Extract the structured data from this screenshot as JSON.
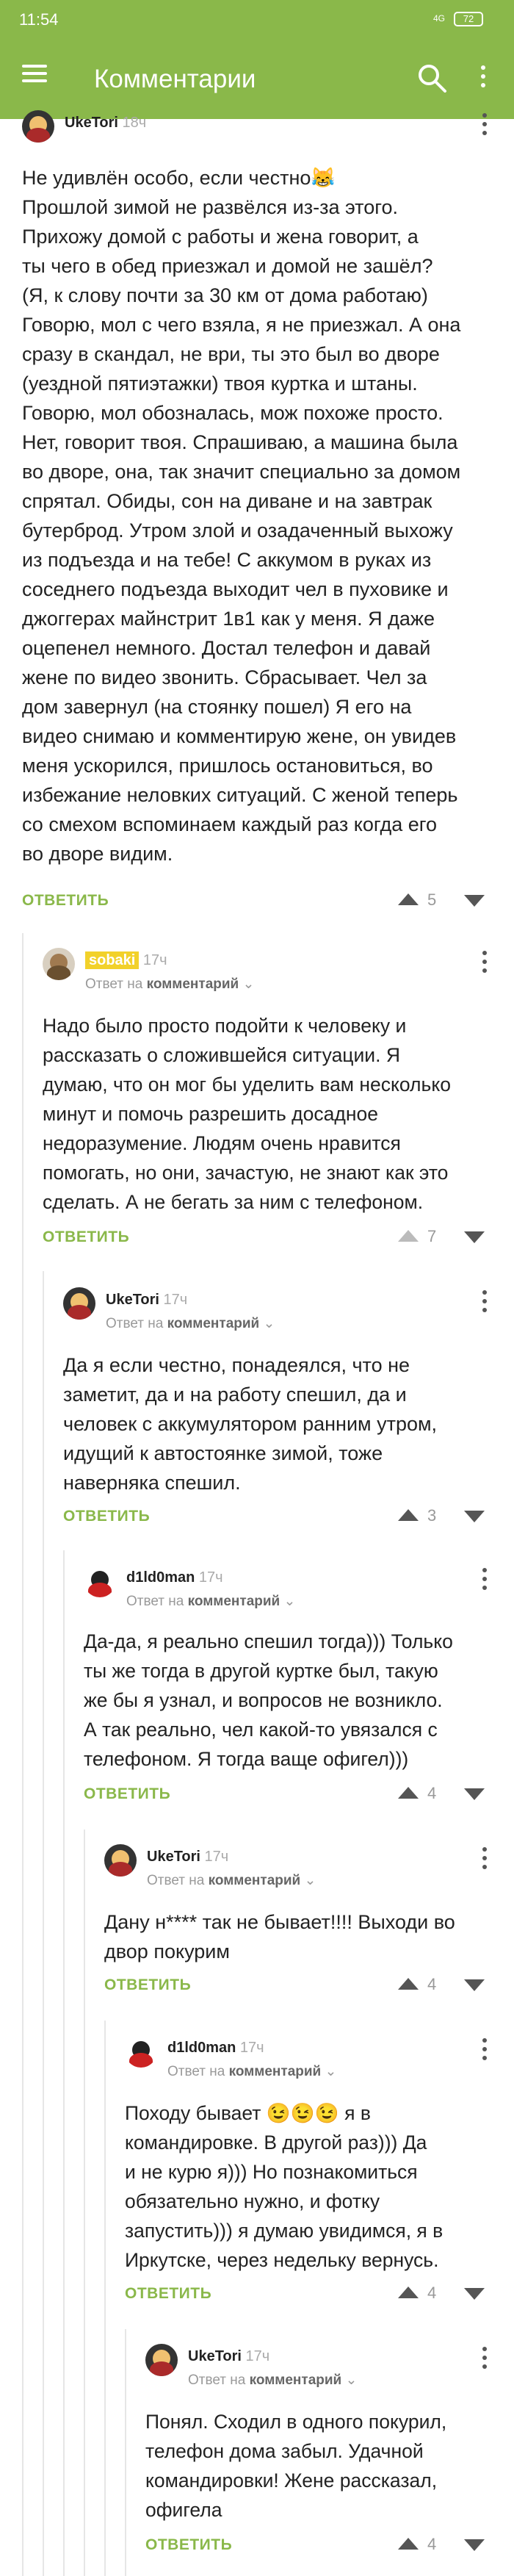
{
  "status_bar": {
    "time": "11:54",
    "network": "4G",
    "battery": "72"
  },
  "app_bar": {
    "title": "Комментарии"
  },
  "labels": {
    "reply": "ОТВЕТИТЬ",
    "reply_to_prefix": "Ответ на",
    "reply_to_target": "комментарий"
  },
  "comments": [
    {
      "author": "UkeTori",
      "age": "18ч",
      "votes": "5",
      "text": "Не удивлён особо, если честно😹\nПрошлой зимой не развёлся из-за этого.\nПрихожу домой с работы и жена говорит, а\nты чего в обед приезжал и домой не зашёл?\n(Я, к слову почти за 30 км от дома работаю)\nГоворю, мол с чего взяла, я не приезжал. А она\nсразу в скандал, не ври, ты это был во дворе\n(уездной пятиэтажки) твоя куртка и штаны.\nГоворю, мол обозналась, мож похоже просто.\nНет, говорит твоя. Спрашиваю, а машина была\nво дворе, она, так значит специально за домом\nспрятал. Обиды, сон на диване и на завтрак\nбутерброд. Утром злой и озадаченный выхожу\nиз подъезда и на тебе! С аккумом в руках из\nсоседнего подъезда выходит чел в пуховике и\nджоггерах майнстрит 1в1 как у меня. Я даже\nоцепенел немного. Достал телефон и давай\nжене по видео звонить. Сбрасывает. Чел за\nдом завернул (на стоянку пошел) Я его на\nвидео снимаю и комментирую жене, он увидев\nменя ускорился, пришлось остановиться, во\nизбежание неловких ситуаций. С женой теперь\nсо смехом вспоминаем каждый раз когда его\nво дворе видим."
    },
    {
      "author": "sobaki",
      "age": "17ч",
      "votes": "7",
      "text": "Надо было просто подойти к человеку и\nрассказать о сложившейся ситуации. Я\nдумаю, что он мог бы уделить вам несколько\nминут и помочь разрешить досадное\nнедоразумение. Людям очень нравится\nпомогать, но они, зачастую, не знают как это\nсделать. А не бегать за ним с телефоном."
    },
    {
      "author": "UkeTori",
      "age": "17ч",
      "votes": "3",
      "text": "Да я если честно, понадеялся, что не\nзаметит, да и на работу спешил, да и\nчеловек с аккумулятором ранним утром,\nидущий к автостоянке зимой, тоже\nнаверняка спешил."
    },
    {
      "author": "d1ld0man",
      "age": "17ч",
      "votes": "4",
      "text": "Да-да, я реально спешил тогда))) Только\nты же тогда в другой куртке был, такую\nже бы я узнал, и вопросов не возникло.\nА так реально, чел какой-то увязался с\nтелефоном. Я тогда ваще офигел)))"
    },
    {
      "author": "UkeTori",
      "age": "17ч",
      "votes": "4",
      "text": "Дану н**** так не бывает!!!! Выходи во\nдвор покурим"
    },
    {
      "author": "d1ld0man",
      "age": "17ч",
      "votes": "4",
      "text": "Походу бывает 😉😉😉 я в\nкомандировке. В другой раз))) Да\nи не курю я))) Но познакомиться\nобязательно нужно, и фотку\nзапустить))) я думаю увидимся, я в\nИркутске, через недельку вернусь."
    },
    {
      "author": "UkeTori",
      "age": "17ч",
      "votes": "4",
      "text": "Понял. Сходил в одного покурил,\nтелефон дома забыл. Удачной\nкомандировки! Жене рассказал,\nофигела"
    }
  ]
}
